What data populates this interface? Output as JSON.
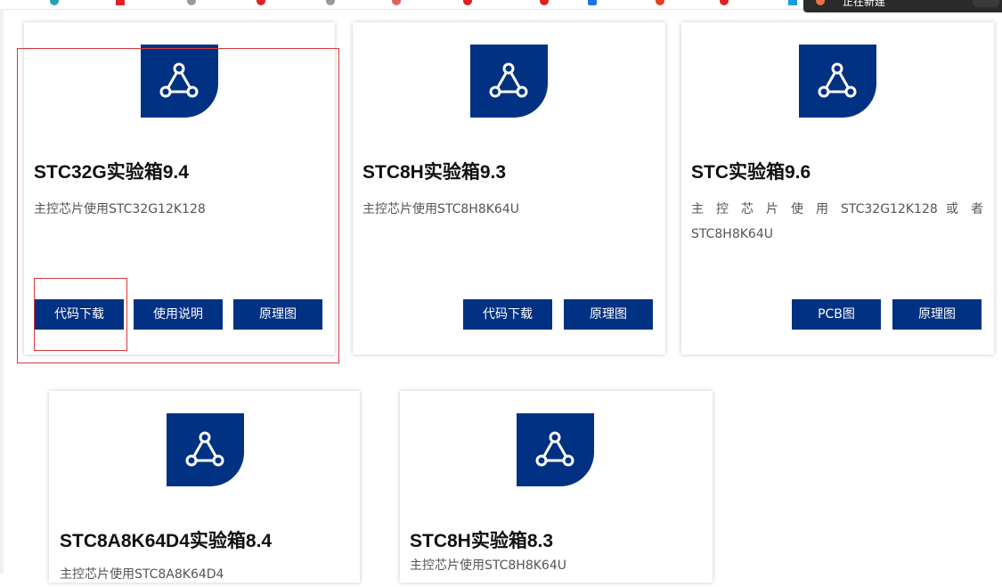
{
  "download_bar": {
    "text": "正在新建"
  },
  "colors": {
    "brand": "#003182",
    "highlight": "#d93a3a"
  },
  "cards": [
    {
      "icon": "share-graph-icon",
      "title": "STC32G实验箱9.4",
      "description": "主控芯片使用STC32G12K128",
      "buttons": [
        "代码下载",
        "使用说明",
        "原理图"
      ]
    },
    {
      "icon": "share-graph-icon",
      "title": "STC8H实验箱9.3",
      "description": "主控芯片使用STC8H8K64U",
      "buttons": [
        "代码下载",
        "原理图"
      ]
    },
    {
      "icon": "share-graph-icon",
      "title": "STC实验箱9.6",
      "description": "主 控 芯 片 使 用 STC32G12K128 或 者 STC8H8K64U",
      "buttons": [
        "PCB图",
        "原理图"
      ]
    },
    {
      "icon": "share-graph-icon",
      "title": "STC8A8K64D4实验箱8.4",
      "description": "主控芯片使用STC8A8K64D4",
      "buttons": []
    },
    {
      "icon": "share-graph-icon",
      "title": "STC8H实验箱8.3",
      "description": "主控芯片使用STC8H8K64U",
      "buttons": []
    }
  ]
}
